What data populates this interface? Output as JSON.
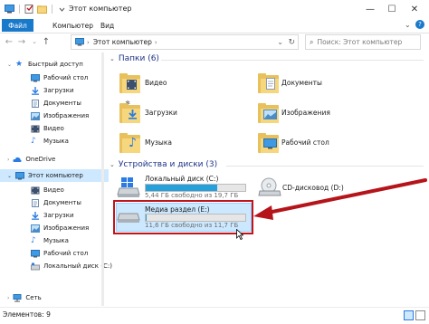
{
  "window": {
    "title": "Этот компьютер",
    "controls": {
      "minimize": "—",
      "maximize": "☐",
      "close": "✕"
    }
  },
  "ribbon": {
    "tabs": [
      "Файл",
      "Компьютер",
      "Вид"
    ],
    "expand_glyph": "⌄",
    "help_glyph": "?"
  },
  "address": {
    "path": "Этот компьютер",
    "search_placeholder": "Поиск: Этот компьютер"
  },
  "sidebar": {
    "items": [
      {
        "label": "Быстрый доступ",
        "icon": "star-icon"
      },
      {
        "label": "Рабочий стол",
        "icon": "desktop-icon",
        "pinned": true
      },
      {
        "label": "Загрузки",
        "icon": "downloads-icon",
        "pinned": true
      },
      {
        "label": "Документы",
        "icon": "documents-icon",
        "pinned": true
      },
      {
        "label": "Изображения",
        "icon": "pictures-icon",
        "pinned": true
      },
      {
        "label": "Видео",
        "icon": "video-icon"
      },
      {
        "label": "Музыка",
        "icon": "music-icon"
      },
      {
        "label": "OneDrive",
        "icon": "onedrive-icon"
      },
      {
        "label": "Этот компьютер",
        "icon": "computer-icon",
        "selected": true
      },
      {
        "label": "Видео",
        "icon": "video-icon"
      },
      {
        "label": "Документы",
        "icon": "documents-icon"
      },
      {
        "label": "Загрузки",
        "icon": "downloads-icon"
      },
      {
        "label": "Изображения",
        "icon": "pictures-icon"
      },
      {
        "label": "Музыка",
        "icon": "music-icon"
      },
      {
        "label": "Рабочий стол",
        "icon": "desktop-icon"
      },
      {
        "label": "Локальный диск (C:)",
        "icon": "drive-icon"
      },
      {
        "label": "Сеть",
        "icon": "network-icon"
      }
    ],
    "pin_glyph": "📌"
  },
  "folders_group": {
    "header": "Папки (6)",
    "items": [
      {
        "label": "Видео",
        "icon": "video-folder-icon"
      },
      {
        "label": "Документы",
        "icon": "documents-folder-icon"
      },
      {
        "label": "Загрузки",
        "icon": "downloads-folder-icon"
      },
      {
        "label": "Изображения",
        "icon": "pictures-folder-icon"
      },
      {
        "label": "Музыка",
        "icon": "music-folder-icon"
      },
      {
        "label": "Рабочий стол",
        "icon": "desktop-folder-icon"
      }
    ]
  },
  "devices_group": {
    "header": "Устройства и диски (3)",
    "drives": [
      {
        "label": "Локальный диск (C:)",
        "free_text": "5,44 ГБ свободно из 19,7 ГБ",
        "used_fraction": 0.72,
        "icon": "windows-drive-icon"
      },
      {
        "label": "CD-дисковод (D:)",
        "icon": "cd-drive-icon"
      },
      {
        "label": "Медиа раздел (E:)",
        "free_text": "11,6 ГБ свободно из 11,7 ГБ",
        "used_fraction": 0.01,
        "icon": "drive-icon",
        "selected": true
      }
    ]
  },
  "status": {
    "items_count": "Элементов: 9"
  },
  "colors": {
    "accent": "#1979ca",
    "annotation": "#c0151b",
    "selection": "#cce8ff",
    "drive_fill": "#26a0da"
  }
}
